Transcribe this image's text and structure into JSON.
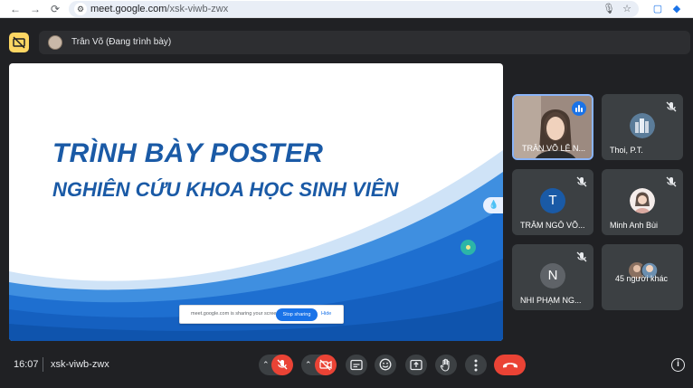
{
  "browser": {
    "url_host": "meet.google.com",
    "url_path": "/xsk-viwb-zwx",
    "back_icon": "←",
    "forward_icon": "→",
    "reload_icon": "⟳",
    "mic_icon": "🎙",
    "star_icon": "☆"
  },
  "presenter": {
    "name": "Trân Võ (Đang trình bày)"
  },
  "slide": {
    "title": "TRÌNH BÀY POSTER",
    "subtitle": "NGHIÊN CỨU KHOA HỌC SINH VIÊN",
    "share_notice": "meet.google.com is sharing your screen.",
    "stop_label": "Stop sharing",
    "hide_label": "Hide"
  },
  "participants": [
    {
      "name": "TRÂN VÕ LÊ N...",
      "type": "video",
      "speaking": true
    },
    {
      "name": "Thoi, P.T.",
      "type": "image",
      "muted": true
    },
    {
      "name": "TRÂM NGÔ VÕ...",
      "type": "initial",
      "initial": "T",
      "color": "#1a5aa6",
      "muted": true
    },
    {
      "name": "Minh Anh Bùi",
      "type": "photo",
      "muted": true
    },
    {
      "name": "NHI PHẠM NG...",
      "type": "initial",
      "initial": "N",
      "color": "#5f6368",
      "muted": true
    },
    {
      "name": "45 người khác",
      "type": "group"
    }
  ],
  "meeting": {
    "time": "16:07",
    "code": "xsk-viwb-zwx"
  },
  "colors": {
    "background": "#202124",
    "tile": "#3c4043",
    "danger": "#ea4335",
    "accent": "#1a73e8",
    "present": "#fdd663"
  }
}
